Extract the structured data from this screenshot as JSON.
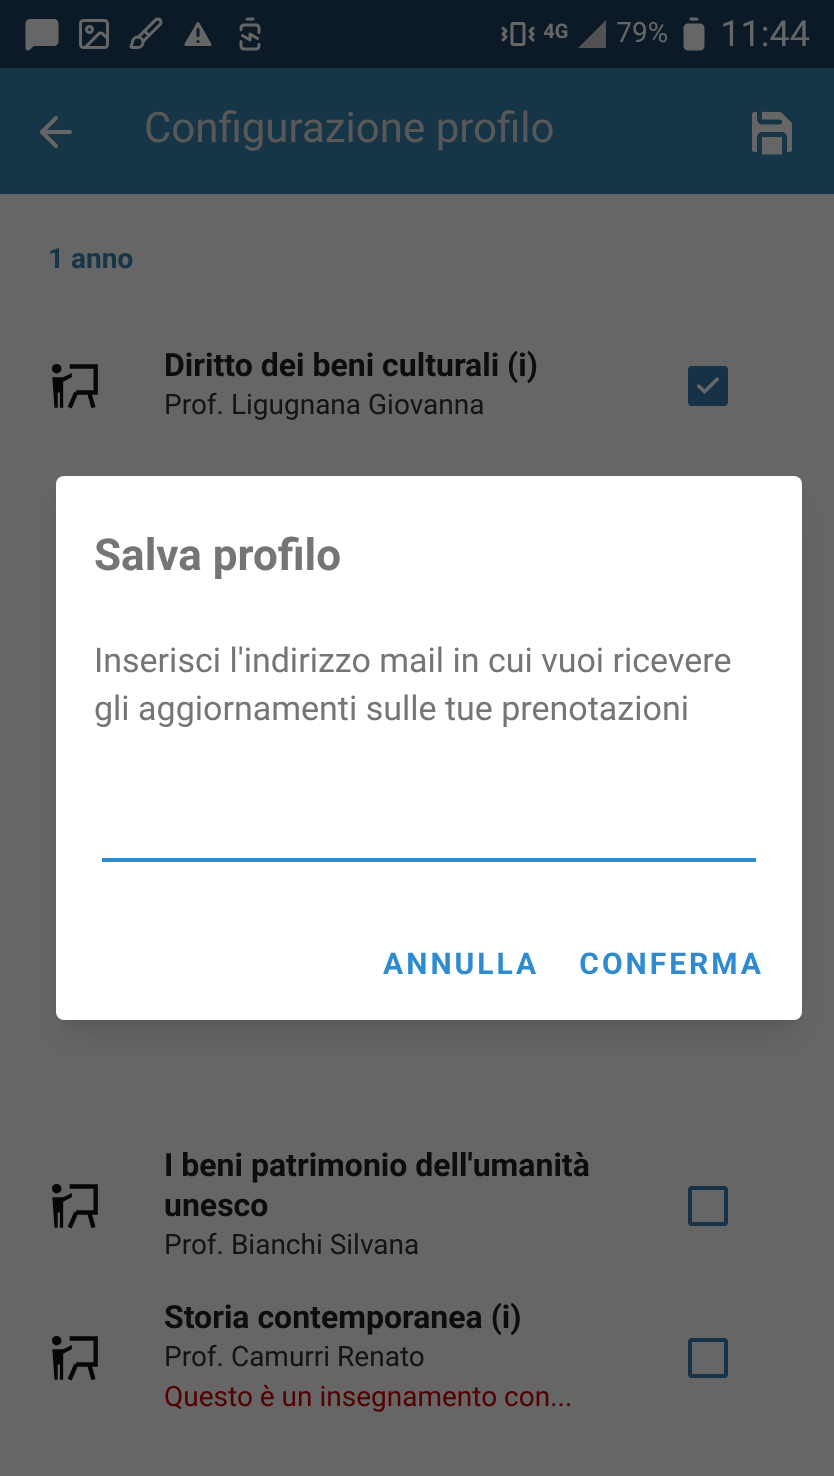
{
  "status_bar": {
    "network": "4G",
    "battery": "79%",
    "time": "11:44"
  },
  "app_bar": {
    "title": "Configurazione profilo"
  },
  "section": {
    "title": "1 anno"
  },
  "courses_top": [
    {
      "title": "Diritto dei beni culturali (i)",
      "teacher": "Prof. Ligugnana Giovanna",
      "checked": true
    }
  ],
  "courses_bottom": [
    {
      "title": "I beni patrimonio dell'umanità unesco",
      "teacher": "Prof. Bianchi Silvana",
      "checked": false
    },
    {
      "title": "Storia contemporanea (i)",
      "teacher": "Prof. Camurri Renato",
      "checked": false,
      "note": "Questo è un insegnamento con..."
    }
  ],
  "dialog": {
    "title": "Salva profilo",
    "message": "Inserisci l'indirizzo mail in cui vuoi ricevere gli aggiornamenti sulle tue prenotazioni",
    "buttons": [
      "ANNULLA",
      "CONFERMA"
    ]
  }
}
